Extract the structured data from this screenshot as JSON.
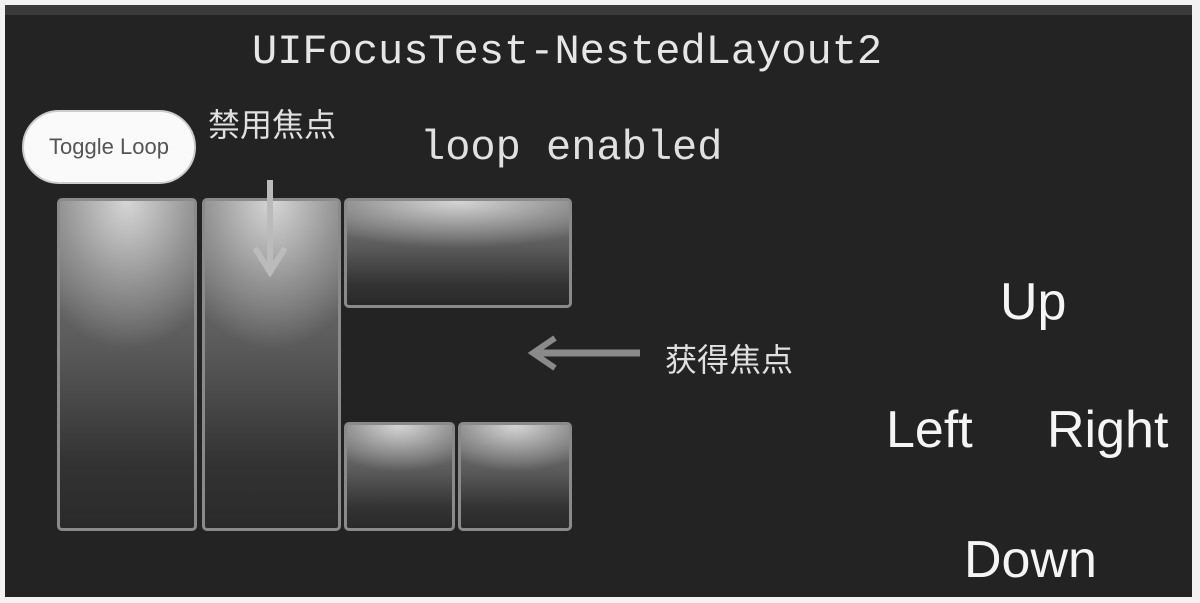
{
  "window": {
    "title": "UIFocusTest-NestedLayout2"
  },
  "toggle_button": {
    "label": "Toggle Loop"
  },
  "status": {
    "text": "loop enabled"
  },
  "annotations": {
    "disabled_focus": "禁用焦点",
    "gained_focus": "获得焦点"
  },
  "directions": {
    "up": "Up",
    "left": "Left",
    "right": "Right",
    "down": "Down"
  },
  "icons": {
    "down_arrow": "arrow-down-icon",
    "left_arrow": "arrow-left-icon"
  }
}
